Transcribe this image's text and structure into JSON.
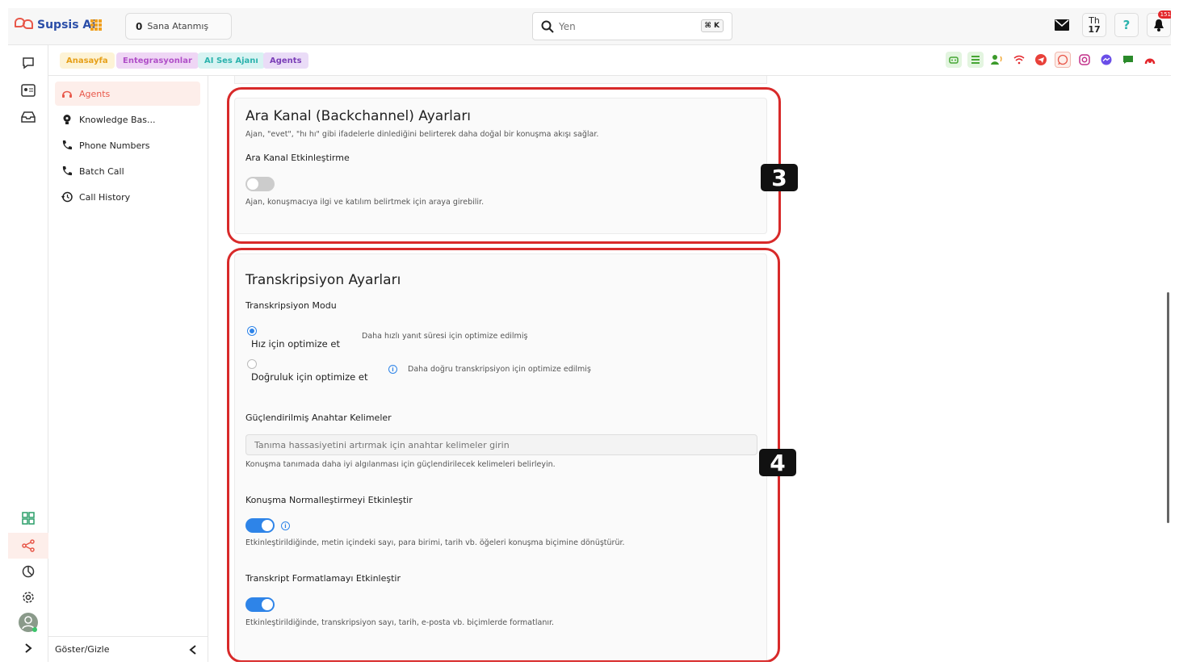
{
  "app": {
    "name": "Supsis Ai"
  },
  "header": {
    "assigned_count": "0",
    "assigned_label": "Sana Atanmış",
    "search_placeholder": "Yen",
    "search_shortcut": "⌘ K",
    "calendar_day": "Th",
    "calendar_date": "17",
    "notification_count": "151"
  },
  "tabs": [
    {
      "label": "Anasayfa",
      "bg": "#fdf3d6",
      "color": "#e6a019"
    },
    {
      "label": "Entegrasyonlar",
      "bg": "#efd6f5",
      "color": "#b04fc8"
    },
    {
      "label": "AI Ses Ajanı",
      "bg": "#d8f3f2",
      "color": "#2bb3ad"
    },
    {
      "label": "Agents",
      "bg": "#eadcf7",
      "color": "#7b3fb8"
    }
  ],
  "channel_icons": [
    "bot-icon",
    "list-icon",
    "voice-agent-icon",
    "wifi-icon",
    "telegram-icon",
    "whatsapp-icon",
    "instagram-icon",
    "messenger-icon",
    "sms-icon",
    "app-icon"
  ],
  "sidebar": {
    "items": [
      {
        "label": "Agents",
        "icon": "agent-icon"
      },
      {
        "label": "Knowledge Bas...",
        "icon": "lightbulb-icon"
      },
      {
        "label": "Phone Numbers",
        "icon": "phone-icon"
      },
      {
        "label": "Batch Call",
        "icon": "phone-icon"
      },
      {
        "label": "Call History",
        "icon": "history-icon"
      }
    ],
    "toggle_label": "Göster/Gizle"
  },
  "backchannel": {
    "title": "Ara Kanal (Backchannel) Ayarları",
    "description": "Ajan, \"evet\", \"hı hı\" gibi ifadelerle dinlediğini belirterek daha doğal bir konuşma akışı sağlar.",
    "enable_label": "Ara Kanal Etkinleştirme",
    "enable_hint": "Ajan, konuşmacıya ilgi ve katılım belirtmek için araya girebilir.",
    "enabled": false,
    "marker": "3"
  },
  "transcription": {
    "title": "Transkripsiyon Ayarları",
    "mode_label": "Transkripsiyon Modu",
    "modes": [
      {
        "label": "Hız için optimize et",
        "hint": "Daha hızlı yanıt süresi için optimize edilmiş",
        "selected": true
      },
      {
        "label": "Doğruluk için optimize et",
        "hint": "Daha doğru transkripsiyon için optimize edilmiş",
        "selected": false
      }
    ],
    "keywords_label": "Güçlendirilmiş Anahtar Kelimeler",
    "keywords_placeholder": "Tanıma hassasiyetini artırmak için anahtar kelimeler girin",
    "keywords_hint": "Konuşma tanımada daha iyi algılanması için güçlendirilecek kelimeleri belirleyin.",
    "normalization_label": "Konuşma Normalleştirmeyi Etkinleştir",
    "normalization_hint": "Etkinleştirildiğinde, metin içindeki sayı, para birimi, tarih vb. öğeleri konuşma biçimine dönüştürür.",
    "normalization_enabled": true,
    "formatting_label": "Transkript Formatlamayı Etkinleştir",
    "formatting_hint": "Etkinleştirildiğinde, transkripsiyon sayı, tarih, e-posta vb. biçimlerde formatlanır.",
    "formatting_enabled": true,
    "marker": "4"
  },
  "colors": {
    "accent": "#e8584a",
    "toggle_on": "#2e84e8",
    "annotation": "#d82a2a"
  }
}
